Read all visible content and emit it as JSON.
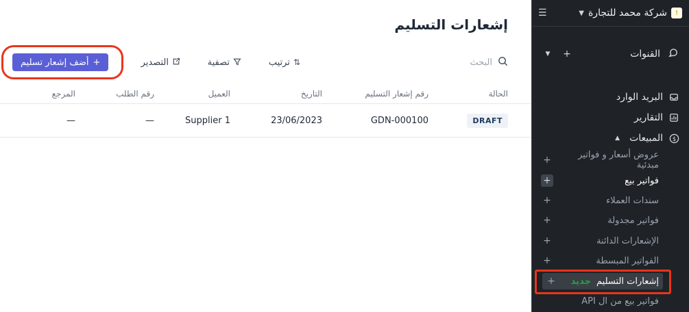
{
  "sidebar": {
    "company_name": "شركة محمد للتجارة",
    "company_logo_text": "!",
    "channels_label": "القنوات",
    "nav": [
      {
        "label": "البريد الوارد",
        "icon": "inbox-icon"
      },
      {
        "label": "التقارير",
        "icon": "reports-icon"
      },
      {
        "label": "المبيعات",
        "icon": "dollar-icon"
      }
    ],
    "sales_items": [
      {
        "label": "عروض أسعار و فواتير مبدئية"
      },
      {
        "label": "فواتير بيع"
      },
      {
        "label": "سندات العملاء"
      },
      {
        "label": "فواتير مجدولة"
      },
      {
        "label": "الإشعارات الدائنة"
      },
      {
        "label": "الفواتير المبسطة"
      },
      {
        "label": "إشعارات التسليم",
        "badge": "جديد"
      },
      {
        "label": "فواتير بيع من ال API"
      }
    ]
  },
  "main": {
    "title": "إشعارات التسليم",
    "search_placeholder": "البحث",
    "sort_label": "ترتيب",
    "filter_label": "تصفية",
    "export_label": "التصدير",
    "add_button_label": "أضف إشعار تسليم",
    "columns": [
      "الحالة",
      "رقم إشعار التسليم",
      "التاريخ",
      "العميل",
      "رقم الطلب",
      "المرجع"
    ],
    "rows": [
      {
        "status": "DRAFT",
        "number": "GDN-000100",
        "date": "23/06/2023",
        "customer": "Supplier 1",
        "order_no": "—",
        "reference": "—"
      }
    ]
  },
  "colors": {
    "accent": "#5b5fd6",
    "sidebar_bg": "#1f2327",
    "new_badge": "#22a447",
    "highlight_ring": "#e8351c"
  }
}
